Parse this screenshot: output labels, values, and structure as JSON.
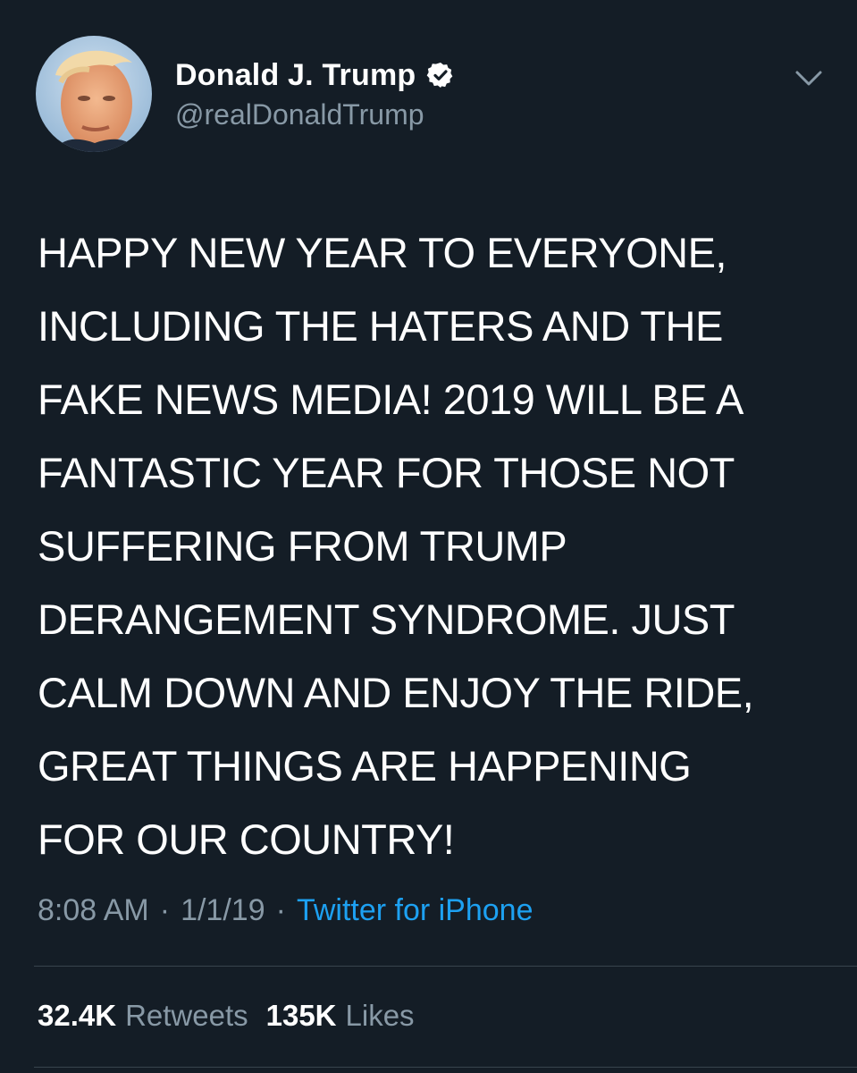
{
  "author": {
    "display_name": "Donald J. Trump",
    "handle": "@realDonaldTrump",
    "verified_icon": "verified-badge-icon",
    "avatar": "profile-photo"
  },
  "menu_icon": "chevron-down-icon",
  "tweet": {
    "text": "HAPPY NEW YEAR TO EVERYONE,\nINCLUDING THE HATERS AND THE\nFAKE NEWS MEDIA! 2019 WILL BE A\nFANTASTIC YEAR FOR THOSE NOT\nSUFFERING FROM TRUMP\nDERANGEMENT SYNDROME. JUST\nCALM DOWN AND ENJOY THE RIDE,\nGREAT THINGS ARE HAPPENING\nFOR OUR COUNTRY!",
    "time": "8:08 AM",
    "separator": "·",
    "date": "1/1/19",
    "source": "Twitter for iPhone"
  },
  "stats": {
    "retweets_count": "32.4K",
    "retweets_label": "Retweets",
    "likes_count": "135K",
    "likes_label": "Likes"
  },
  "colors": {
    "background": "#141d26",
    "text": "#ffffff",
    "secondary_text": "#8899a6",
    "link": "#1da1f2",
    "divider": "#38444d"
  }
}
